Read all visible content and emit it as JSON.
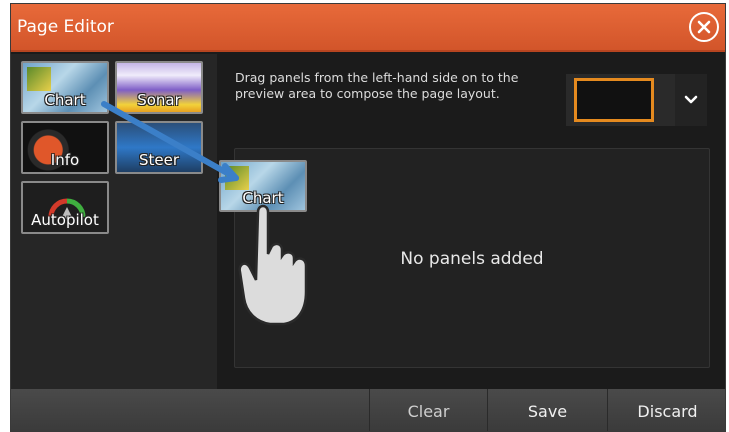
{
  "window": {
    "title": "Page Editor"
  },
  "panels": [
    {
      "label": "Chart"
    },
    {
      "label": "Sonar"
    },
    {
      "label": "Info"
    },
    {
      "label": "Steer"
    },
    {
      "label": "Autopilot"
    }
  ],
  "instructions": "Drag panels from the left-hand side on to the preview area to compose the page layout.",
  "preview": {
    "empty_text": "No panels added"
  },
  "dragging_panel": {
    "label": "Chart"
  },
  "footer": {
    "clear_label": "Clear",
    "save_label": "Save",
    "discard_label": "Discard"
  },
  "colors": {
    "accent": "#d9582b",
    "layout_highlight": "#e58a1f"
  },
  "icons": {
    "close": "close-circle-icon",
    "dropdown": "chevron-down-icon",
    "cursor": "hand-pointer-icon"
  }
}
